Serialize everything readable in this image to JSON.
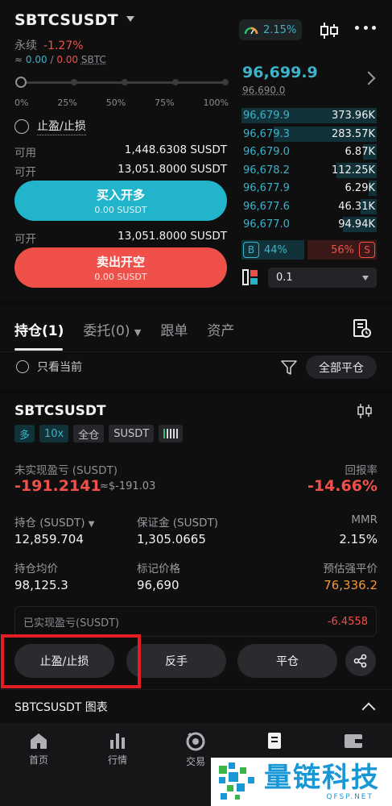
{
  "header": {
    "symbol": "SBTCSUSDT",
    "contract_type": "永续",
    "change_pct": "-1.27%",
    "approx_prefix": "≈",
    "approx_val1": "0.00",
    "approx_sep": "/",
    "approx_val2": "0.00",
    "approx_unit": "SBTC",
    "funding_rate": "2.15%"
  },
  "slider": {
    "labels": [
      "0%",
      "25%",
      "50%",
      "75%",
      "100%"
    ],
    "value_pct": 0
  },
  "order_form": {
    "tpsl_label": "止盈/止损",
    "available_label": "可用",
    "available_value": "1,448.6308 SUSDT",
    "open_long_label": "可开",
    "open_long_value": "13,051.8000 SUSDT",
    "buy_label": "买入开多",
    "buy_sub": "0.00 SUSDT",
    "open_short_label": "可开",
    "open_short_value": "13,051.8000 SUSDT",
    "sell_label": "卖出开空",
    "sell_sub": "0.00 SUSDT"
  },
  "order_book": {
    "last_price": "96,699.9",
    "mark_price": "96,690.0",
    "bids": [
      {
        "price": "96,679.9",
        "size": "373.96K",
        "depth": 1.0
      },
      {
        "price": "96,679.3",
        "size": "283.57K",
        "depth": 0.76
      },
      {
        "price": "96,679.0",
        "size": "6.87K",
        "depth": 0.1
      },
      {
        "price": "96,678.2",
        "size": "112.25K",
        "depth": 0.3
      },
      {
        "price": "96,677.9",
        "size": "6.29K",
        "depth": 0.06
      },
      {
        "price": "96,677.6",
        "size": "46.31K",
        "depth": 0.12
      },
      {
        "price": "96,677.0",
        "size": "94.94K",
        "depth": 0.25
      }
    ],
    "buy_tag": "B",
    "buy_ratio": "44%",
    "sell_ratio": "56%",
    "sell_tag": "S",
    "precision": "0.1"
  },
  "tabs": {
    "items": [
      "持仓(1)",
      "委托(0)",
      "跟单",
      "资产"
    ],
    "current_only": "只看当前",
    "close_all": "全部平仓"
  },
  "position": {
    "symbol": "SBTCSUSDT",
    "tags": [
      "多",
      "10x",
      "全仓",
      "SUSDT"
    ],
    "upnl_label": "未实现盈亏 (SUSDT)",
    "roe_label": "回报率",
    "upnl_value": "-191.2141",
    "upnl_approx": "≈$-191.03",
    "roe_value": "-14.66%",
    "size_label": "持仓 (SUSDT)",
    "size_value": "12,859.704",
    "margin_label": "保证金 (SUSDT)",
    "margin_value": "1,305.0665",
    "mmr_label": "MMR",
    "mmr_value": "2.15%",
    "entry_label": "持仓均价",
    "entry_value": "98,125.3",
    "mark_label": "标记价格",
    "mark_value": "96,690",
    "liq_label": "预估强平价",
    "liq_value": "76,336.2",
    "realized_label": "已实现盈亏(SUSDT)",
    "realized_value": "-6.4558",
    "btn_tpsl": "止盈/止损",
    "btn_reverse": "反手",
    "btn_close": "平仓"
  },
  "chart_section": {
    "title": "SBTCSUSDT 图表"
  },
  "nav": {
    "items": [
      "首页",
      "行情",
      "交易",
      "",
      ""
    ]
  },
  "watermark": {
    "name": "量链科技",
    "url": "QFSP.NET"
  },
  "colors": {
    "accent_teal": "#21b4cb",
    "sell_red": "#f0504a",
    "liq_orange": "#f2963c",
    "highlight_red": "#e21e24"
  }
}
